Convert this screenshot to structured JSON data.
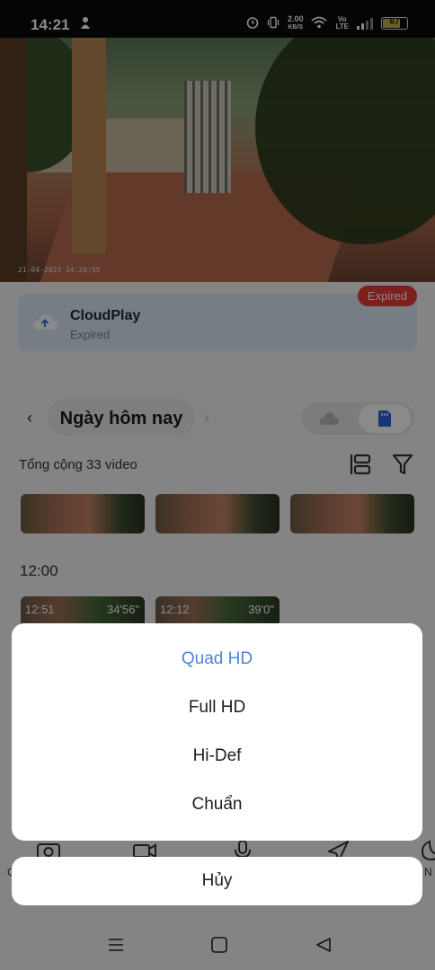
{
  "status_bar": {
    "time": "14:21",
    "net_speed_value": "2.00",
    "net_speed_unit": "KB/S",
    "network_type_top": "Vo",
    "network_type_bottom": "LTE",
    "battery_level": "67"
  },
  "camera": {
    "timestamp_overlay": "21-04-2023 14:20:55"
  },
  "cloud_card": {
    "title": "CloudPlay",
    "subtitle": "Expired",
    "badge": "Expired"
  },
  "date_nav": {
    "prev_symbol": "‹",
    "label": "Ngày hôm nay",
    "next_symbol": "›"
  },
  "recordings": {
    "total_label": "Tổng cộng 33 video",
    "group_time": "12:00",
    "clips": [
      {
        "start": "12:51",
        "duration": "34'56\""
      },
      {
        "start": "12:12",
        "duration": "39'0\""
      }
    ]
  },
  "toolbar_partial": {
    "left_edge_label": "C",
    "right_edge_label": "N"
  },
  "quality_sheet": {
    "options": [
      "Quad HD",
      "Full HD",
      "Hi-Def",
      "Chuẩn"
    ],
    "selected_index": 0,
    "cancel_label": "Hủy"
  },
  "colors": {
    "accent": "#4a84de",
    "expired_badge": "#e43c35"
  }
}
